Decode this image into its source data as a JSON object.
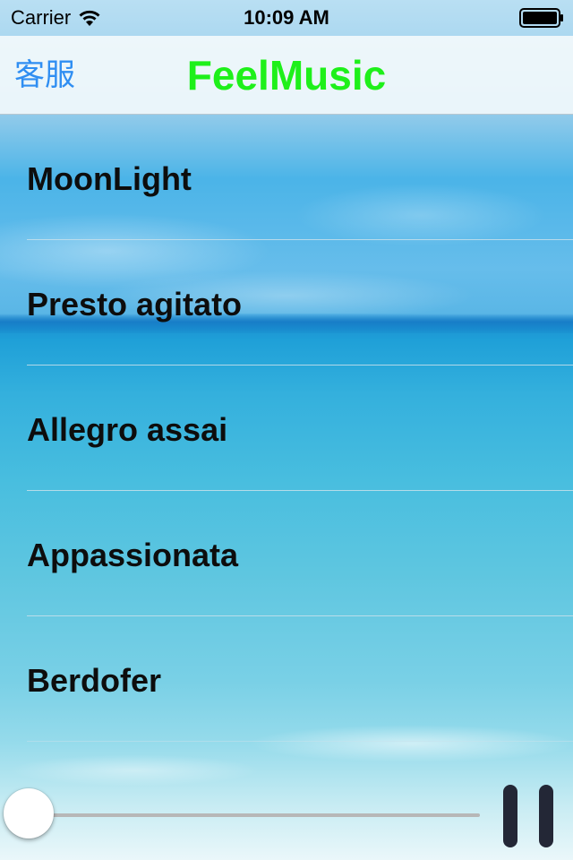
{
  "status_bar": {
    "carrier": "Carrier",
    "time": "10:09 AM",
    "wifi_icon": "wifi-icon",
    "battery_icon": "battery-icon"
  },
  "nav_bar": {
    "left_button": "客服",
    "title": "FeelMusic",
    "title_color": "#1ef01a",
    "accent_color": "#2f8ef2"
  },
  "songs": [
    {
      "title": "MoonLight"
    },
    {
      "title": "Presto agitato"
    },
    {
      "title": "Allegro assai"
    },
    {
      "title": "Appassionata"
    },
    {
      "title": "Berdofer"
    }
  ],
  "player": {
    "progress": 0.0,
    "play_state": "playing",
    "pause_icon": "pause-icon"
  }
}
